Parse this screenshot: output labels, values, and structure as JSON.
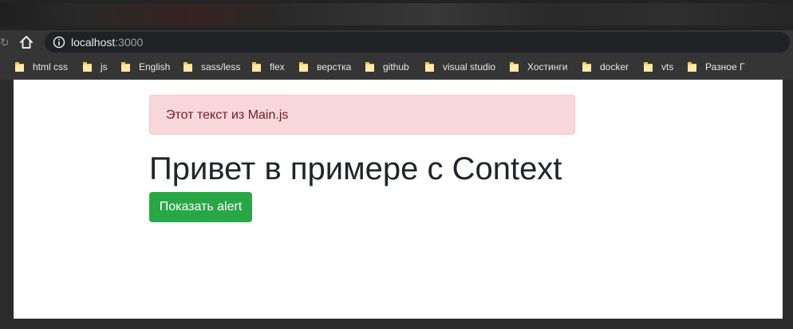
{
  "browser": {
    "url_host": "localhost",
    "url_port": ":3000",
    "bookmarks": [
      {
        "label": "html css"
      },
      {
        "label": "js"
      },
      {
        "label": "English"
      },
      {
        "label": "sass/less"
      },
      {
        "label": "flex"
      },
      {
        "label": "верстка"
      },
      {
        "label": "github"
      },
      {
        "label": "visual studio"
      },
      {
        "label": "Хостинги"
      },
      {
        "label": "docker"
      },
      {
        "label": "vts"
      },
      {
        "label": "Разное Г"
      }
    ],
    "icons": {
      "home": "home-icon",
      "info": "info-icon",
      "reload": "reload-icon",
      "folder": "folder-icon"
    },
    "colors": {
      "folder": "#f4c542"
    }
  },
  "page": {
    "alert_text": "Этот текст из Main.js",
    "heading": "Привет в примере с Context",
    "button_label": "Показать alert",
    "colors": {
      "alert_bg": "#f8d7da",
      "alert_text": "#721c24",
      "button_bg": "#28a745"
    }
  }
}
